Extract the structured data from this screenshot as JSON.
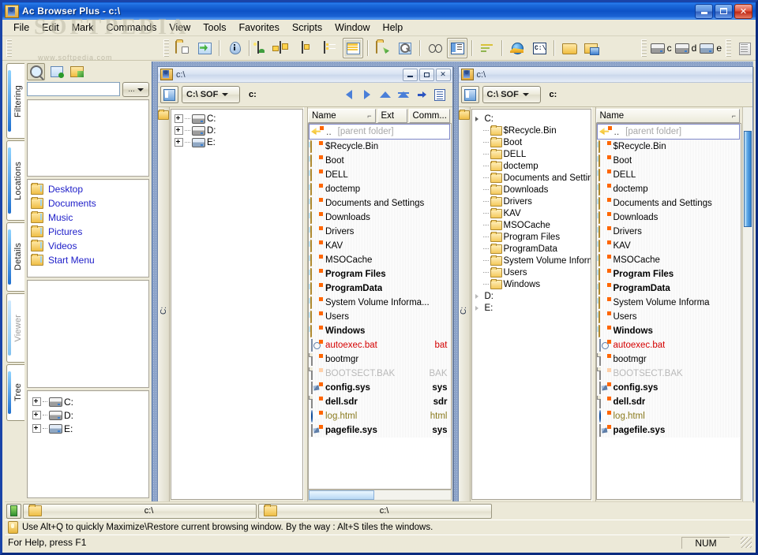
{
  "window": {
    "title": "Ac Browser Plus - c:\\",
    "icon": "app-icon",
    "buttons": {
      "minimize": "minimize",
      "maximize": "maximize",
      "close": "close"
    },
    "watermark": "SOFTPEDIA",
    "watermark_url": "www.softpedia.com"
  },
  "menu": {
    "items": [
      "File",
      "Edit",
      "Mark",
      "Commands",
      "View",
      "Tools",
      "Favorites",
      "Scripts",
      "Window",
      "Help"
    ]
  },
  "toolbar": {
    "groups": [
      {
        "icons": [
          "folder-properties-icon",
          "refresh-icon"
        ]
      },
      {
        "icons": [
          "info-icon"
        ]
      },
      {
        "icons": [
          "image-view-icon",
          "thumbnail-view-icon",
          "small-icon-view-icon",
          "list-view-icon",
          "details-view-icon"
        ]
      },
      {
        "icons": [
          "share-folder-icon",
          "search-icon"
        ]
      },
      {
        "icons": [
          "compare-icon",
          "split-panel-icon"
        ]
      },
      {
        "icons": [
          "sort-icon"
        ]
      },
      {
        "icons": [
          "internet-icon",
          "command-prompt-icon"
        ]
      },
      {
        "icons": [
          "open-folder-icon",
          "network-folder-icon"
        ]
      }
    ],
    "drives": [
      {
        "icon": "drive-icon",
        "label": "c"
      },
      {
        "icon": "drive-icon",
        "label": "d"
      },
      {
        "icon": "cd-drive-icon",
        "label": "e"
      }
    ],
    "notes_icon": "notepad-icon"
  },
  "sidebar": {
    "tabs": [
      {
        "label": "Filtering",
        "active": true
      },
      {
        "label": "Locations",
        "active": false
      },
      {
        "label": "Details",
        "active": false
      },
      {
        "label": "Viewer",
        "active": false,
        "dimmed": true
      },
      {
        "label": "Tree",
        "active": false
      }
    ],
    "filter_icons": [
      "filter-search-icon",
      "filter-edit-icon",
      "filter-open-icon"
    ],
    "filter_input": {
      "value": "",
      "placeholder": ""
    },
    "filter_dropdown_label": "...",
    "places": [
      {
        "label": "Desktop",
        "icon": "folder-icon"
      },
      {
        "label": "Documents",
        "icon": "folder-icon"
      },
      {
        "label": "Music",
        "icon": "folder-icon"
      },
      {
        "label": "Pictures",
        "icon": "folder-icon"
      },
      {
        "label": "Videos",
        "icon": "folder-icon"
      },
      {
        "label": "Start Menu",
        "icon": "folder-icon"
      }
    ],
    "tree": [
      {
        "label": "C:",
        "icon": "drive-icon",
        "expander": "plus"
      },
      {
        "label": "D:",
        "icon": "drive-icon",
        "expander": "plus"
      },
      {
        "label": "E:",
        "icon": "cd-drive-icon",
        "expander": "plus"
      }
    ]
  },
  "panels": [
    {
      "id": "left",
      "title": "c:\\",
      "drive_combo": "C:\\ SOF",
      "path": "c:",
      "side_label": "C:",
      "nav_icons": [
        "back-icon",
        "forward-icon",
        "up-icon",
        "root-icon",
        "go-icon",
        "list-icon"
      ],
      "columns": [
        {
          "label": "Name",
          "sort": "ascending"
        },
        {
          "label": "Ext"
        },
        {
          "label": "Comm..."
        }
      ],
      "tree": [
        {
          "label": "C:",
          "icon": "drive-icon",
          "expander": "plus",
          "depth": 0
        },
        {
          "label": "D:",
          "icon": "drive-icon",
          "expander": "plus",
          "depth": 0
        },
        {
          "label": "E:",
          "icon": "cd-drive-icon",
          "expander": "plus",
          "depth": 0
        }
      ],
      "files": [
        {
          "name": "..",
          "ext": "",
          "icon": "parent-folder-icon",
          "style": "parent",
          "hint": "[parent folder]"
        },
        {
          "name": "$Recycle.Bin",
          "ext": "",
          "icon": "folder-icon",
          "style": "normal"
        },
        {
          "name": "Boot",
          "ext": "",
          "icon": "folder-icon",
          "style": "normal"
        },
        {
          "name": "DELL",
          "ext": "",
          "icon": "folder-icon",
          "style": "normal"
        },
        {
          "name": "doctemp",
          "ext": "",
          "icon": "folder-icon",
          "style": "normal"
        },
        {
          "name": "Documents and Settings",
          "ext": "",
          "icon": "folder-icon",
          "style": "normal"
        },
        {
          "name": "Downloads",
          "ext": "",
          "icon": "folder-icon",
          "style": "normal"
        },
        {
          "name": "Drivers",
          "ext": "",
          "icon": "folder-icon",
          "style": "normal"
        },
        {
          "name": "KAV",
          "ext": "",
          "icon": "folder-icon",
          "style": "normal"
        },
        {
          "name": "MSOCache",
          "ext": "",
          "icon": "folder-icon",
          "style": "normal"
        },
        {
          "name": "Program Files",
          "ext": "",
          "icon": "folder-icon",
          "style": "bold"
        },
        {
          "name": "ProgramData",
          "ext": "",
          "icon": "folder-icon",
          "style": "bold"
        },
        {
          "name": "System Volume Informa...",
          "ext": "",
          "icon": "folder-icon",
          "style": "normal"
        },
        {
          "name": "Users",
          "ext": "",
          "icon": "folder-icon",
          "style": "normal"
        },
        {
          "name": "Windows",
          "ext": "",
          "icon": "folder-icon",
          "style": "bold"
        },
        {
          "name": "autoexec.bat",
          "ext": "bat",
          "icon": "batch-file-icon",
          "style": "red"
        },
        {
          "name": "bootmgr",
          "ext": "",
          "icon": "document-icon",
          "style": "normal"
        },
        {
          "name": "BOOTSECT.BAK",
          "ext": "BAK",
          "icon": "document-icon",
          "style": "gray"
        },
        {
          "name": "config.sys",
          "ext": "sys",
          "icon": "system-file-icon",
          "style": "bold"
        },
        {
          "name": "dell.sdr",
          "ext": "sdr",
          "icon": "document-icon",
          "style": "bold"
        },
        {
          "name": "log.html",
          "ext": "html",
          "icon": "html-file-icon",
          "style": "olive"
        },
        {
          "name": "pagefile.sys",
          "ext": "sys",
          "icon": "system-file-icon",
          "style": "bold"
        }
      ]
    },
    {
      "id": "right",
      "title": "c:\\",
      "drive_combo": "C:\\ SOF",
      "path": "c:",
      "side_label": "C:",
      "columns": [
        {
          "label": "Name",
          "sort": "ascending"
        }
      ],
      "tree": [
        {
          "label": "C:",
          "icon": "drive-icon",
          "expander": "expanded",
          "depth": 0
        },
        {
          "label": "$Recycle.Bin",
          "icon": "folder-icon",
          "depth": 1
        },
        {
          "label": "Boot",
          "icon": "folder-icon",
          "depth": 1
        },
        {
          "label": "DELL",
          "icon": "folder-icon",
          "depth": 1
        },
        {
          "label": "doctemp",
          "icon": "folder-icon",
          "depth": 1
        },
        {
          "label": "Documents and Settings",
          "icon": "folder-icon",
          "depth": 1
        },
        {
          "label": "Downloads",
          "icon": "folder-icon",
          "depth": 1
        },
        {
          "label": "Drivers",
          "icon": "folder-icon",
          "depth": 1
        },
        {
          "label": "KAV",
          "icon": "folder-icon",
          "depth": 1
        },
        {
          "label": "MSOCache",
          "icon": "folder-icon",
          "depth": 1
        },
        {
          "label": "Program Files",
          "icon": "folder-icon",
          "depth": 1
        },
        {
          "label": "ProgramData",
          "icon": "folder-icon",
          "depth": 1
        },
        {
          "label": "System Volume Informati",
          "icon": "folder-icon",
          "depth": 1
        },
        {
          "label": "Users",
          "icon": "folder-icon",
          "depth": 1
        },
        {
          "label": "Windows",
          "icon": "folder-icon",
          "depth": 1
        },
        {
          "label": "D:",
          "icon": "",
          "expander": "collapsed",
          "depth": 0
        },
        {
          "label": "E:",
          "icon": "",
          "expander": "collapsed",
          "depth": 0
        }
      ],
      "files": [
        {
          "name": "..",
          "ext": "",
          "icon": "parent-folder-icon",
          "style": "parent",
          "hint": "[parent folder]"
        },
        {
          "name": "$Recycle.Bin",
          "ext": "",
          "icon": "folder-icon",
          "style": "normal"
        },
        {
          "name": "Boot",
          "ext": "",
          "icon": "folder-icon",
          "style": "normal"
        },
        {
          "name": "DELL",
          "ext": "",
          "icon": "folder-icon",
          "style": "normal"
        },
        {
          "name": "doctemp",
          "ext": "",
          "icon": "folder-icon",
          "style": "normal"
        },
        {
          "name": "Documents and Settings",
          "ext": "",
          "icon": "folder-icon",
          "style": "normal"
        },
        {
          "name": "Downloads",
          "ext": "",
          "icon": "folder-icon",
          "style": "normal"
        },
        {
          "name": "Drivers",
          "ext": "",
          "icon": "folder-icon",
          "style": "normal"
        },
        {
          "name": "KAV",
          "ext": "",
          "icon": "folder-icon",
          "style": "normal"
        },
        {
          "name": "MSOCache",
          "ext": "",
          "icon": "folder-icon",
          "style": "normal"
        },
        {
          "name": "Program Files",
          "ext": "",
          "icon": "folder-icon",
          "style": "bold"
        },
        {
          "name": "ProgramData",
          "ext": "",
          "icon": "folder-icon",
          "style": "bold"
        },
        {
          "name": "System Volume Informa",
          "ext": "",
          "icon": "folder-icon",
          "style": "normal"
        },
        {
          "name": "Users",
          "ext": "",
          "icon": "folder-icon",
          "style": "normal"
        },
        {
          "name": "Windows",
          "ext": "",
          "icon": "folder-icon",
          "style": "bold"
        },
        {
          "name": "autoexec.bat",
          "ext": "",
          "icon": "batch-file-icon",
          "style": "red"
        },
        {
          "name": "bootmgr",
          "ext": "",
          "icon": "document-icon",
          "style": "normal"
        },
        {
          "name": "BOOTSECT.BAK",
          "ext": "",
          "icon": "document-icon",
          "style": "gray"
        },
        {
          "name": "config.sys",
          "ext": "",
          "icon": "system-file-icon",
          "style": "bold"
        },
        {
          "name": "dell.sdr",
          "ext": "",
          "icon": "document-icon",
          "style": "bold"
        },
        {
          "name": "log.html",
          "ext": "",
          "icon": "html-file-icon",
          "style": "olive"
        },
        {
          "name": "pagefile.sys",
          "ext": "",
          "icon": "system-file-icon",
          "style": "bold"
        }
      ]
    }
  ],
  "window_bar": {
    "tabs": [
      {
        "label": "c:\\",
        "icon": "folder-icon"
      },
      {
        "label": "c:\\",
        "icon": "folder-icon"
      }
    ]
  },
  "tip": {
    "icon": "tip-icon",
    "text": "Use Alt+Q to quickly Maximize\\Restore current browsing window. By the way : Alt+S tiles the windows."
  },
  "status": {
    "help_text": "For Help, press F1",
    "num_lock": "NUM"
  },
  "colors": {
    "titlebar": "#0d52c6",
    "face": "#ece9d8",
    "mdi_background": "#8ca3c9",
    "link": "#1c1cc8",
    "red_file": "#d40000",
    "gray_file": "#b9b9b9",
    "olive_file": "#8a7a1e",
    "overlay_badge": "#ff6600"
  }
}
